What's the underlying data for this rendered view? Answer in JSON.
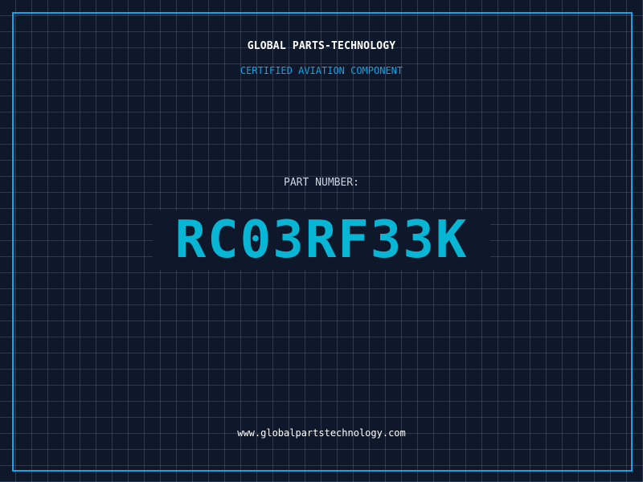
{
  "header": {
    "company_name": "GLOBAL PARTS-TECHNOLOGY",
    "subtitle": "CERTIFIED AVIATION COMPONENT"
  },
  "part": {
    "label": "PART NUMBER:",
    "number": "RC03RF33K"
  },
  "footer": {
    "website": "www.globalpartstechnology.com"
  },
  "colors": {
    "background": "#0f172a",
    "grid": "#0e7490",
    "accent": "#0ea5e9",
    "part_number": "#06b6d4",
    "text": "#ffffff",
    "muted": "#cbd5e1"
  }
}
